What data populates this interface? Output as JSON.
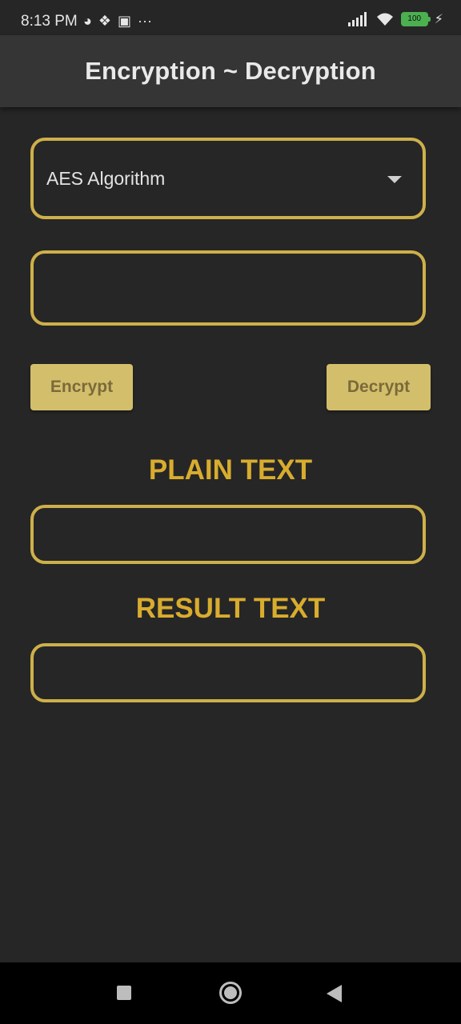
{
  "status_bar": {
    "time": "8:13 PM",
    "left_icons": [
      "notification-icon",
      "twitter-icon",
      "instagram-icon",
      "more-icon"
    ],
    "right_icons": [
      "signal-icon",
      "wifi-icon",
      "battery-icon",
      "charging-icon"
    ],
    "battery_level": "100"
  },
  "app_bar": {
    "title": "Encryption ~ Decryption"
  },
  "algorithm_dropdown": {
    "selected": "AES Algorithm"
  },
  "key_input": {
    "value": ""
  },
  "buttons": {
    "encrypt": "Encrypt",
    "decrypt": "Decrypt"
  },
  "plain_text": {
    "label": "PLAIN TEXT",
    "value": ""
  },
  "result_text": {
    "label": "RESULT TEXT",
    "value": ""
  },
  "colors": {
    "background": "#262626",
    "app_bar": "#353535",
    "accent_border": "#cdb04a",
    "label_gold": "#d9ac2e",
    "button_fill": "#d3bf6b",
    "button_text": "#7b6a3a"
  },
  "nav_bar": {
    "icons": [
      "recents-icon",
      "home-icon",
      "back-icon"
    ]
  }
}
